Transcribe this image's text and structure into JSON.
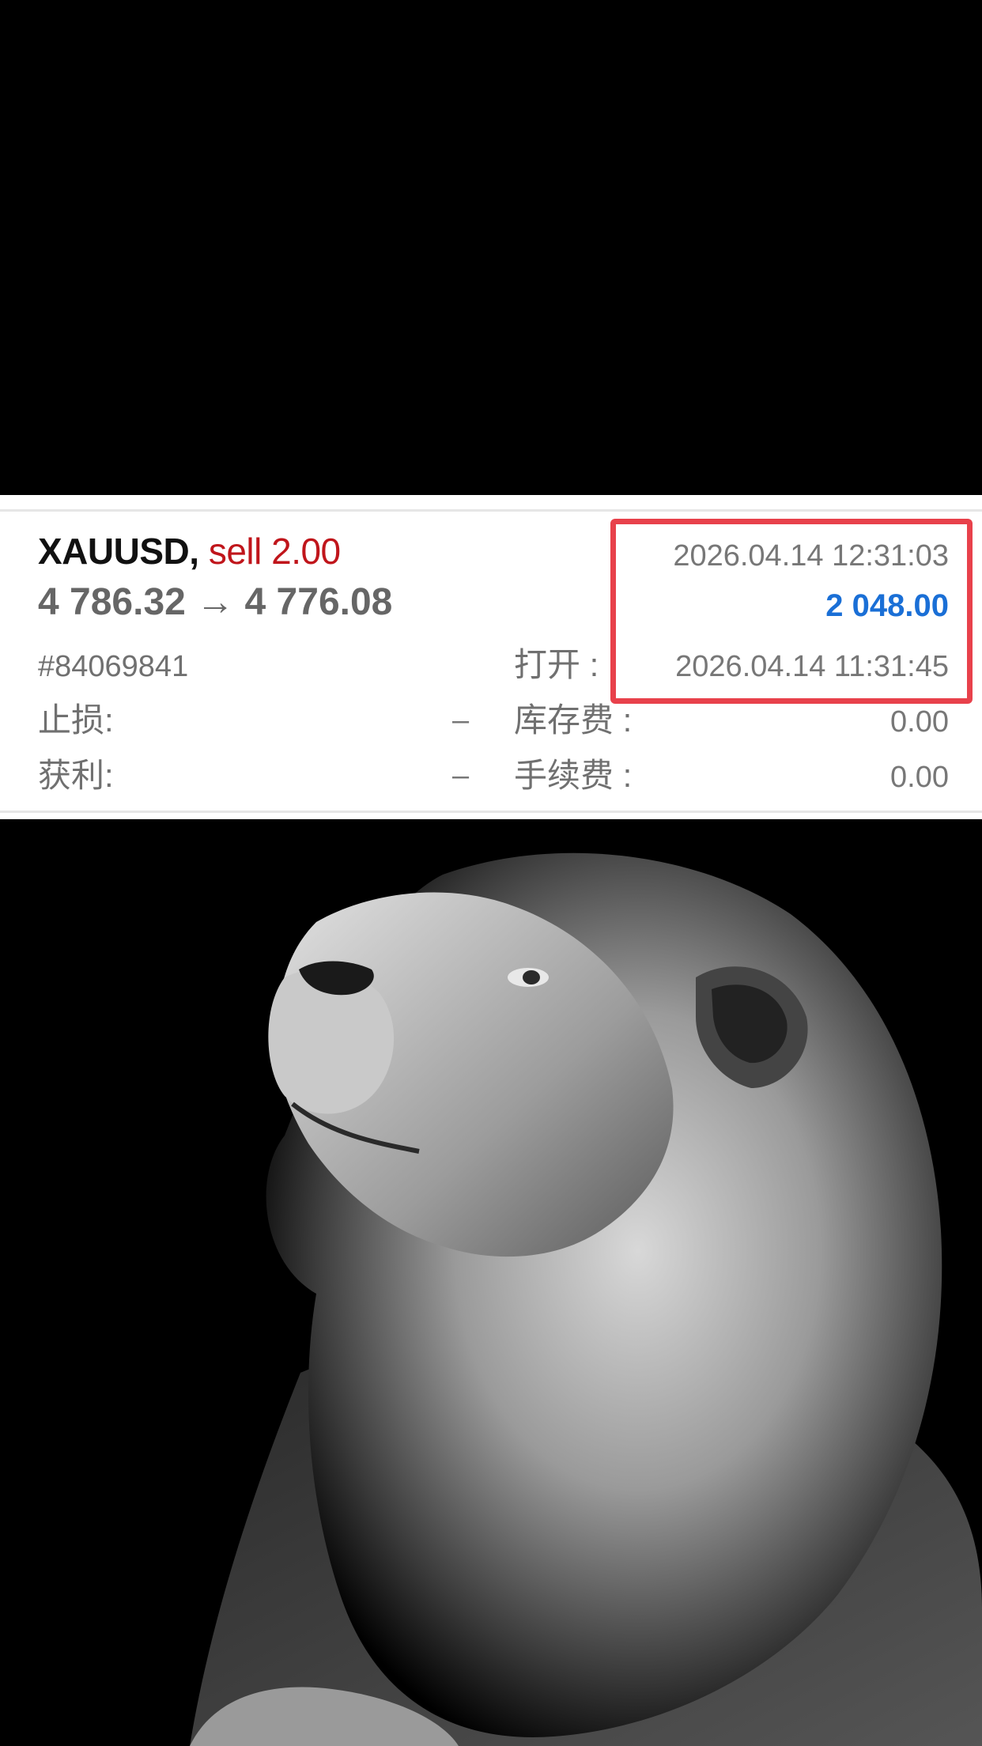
{
  "trade": {
    "symbol": "XAUUSD,",
    "side": "sell 2.00",
    "price_change": "4 786.32 → 4 776.08",
    "close_time": "2026.04.14 12:31:03",
    "profit": "2 048.00",
    "ticket": "#84069841",
    "open_label": "打开 :",
    "open_time": "2026.04.14 11:31:45",
    "stop_loss_label": "止损:",
    "stop_loss_value": "–",
    "swap_label": "库存费 :",
    "swap_value": "0.00",
    "take_profit_label": "获利:",
    "take_profit_value": "–",
    "commission_label": "手续费 :",
    "commission_value": "0.00"
  },
  "colors": {
    "sell": "#c0151b",
    "profit": "#1a6fd6",
    "highlight": "#e8414b"
  },
  "photo": {
    "subject": "lion-portrait"
  }
}
